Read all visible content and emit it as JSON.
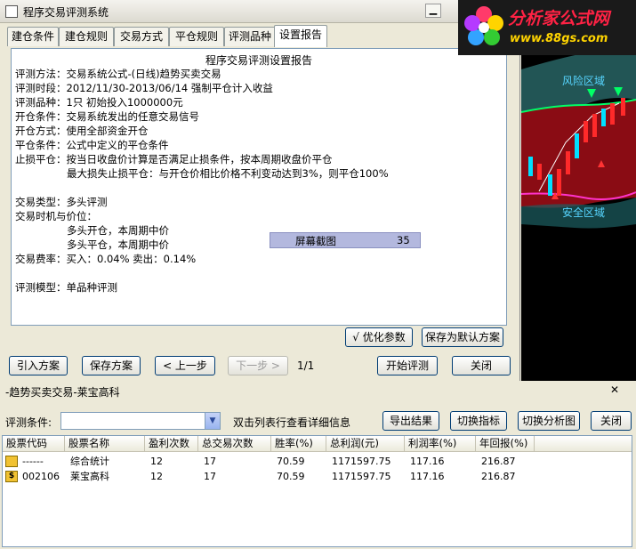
{
  "window": {
    "title": "程序交易评测系统",
    "minimize_glyph": "▁"
  },
  "tabs": [
    {
      "label": "建仓条件"
    },
    {
      "label": "建仓规则"
    },
    {
      "label": "交易方式"
    },
    {
      "label": "平仓规则"
    },
    {
      "label": "评测品种"
    },
    {
      "label": "设置报告"
    }
  ],
  "report": {
    "title": "程序交易评测设置报告",
    "lines": [
      "评测方法：交易系统公式-(日线)趋势买卖交易",
      "评测时段：2012/11/30-2013/06/14 强制平仓计入收益",
      "评测品种：1只 初始投入1000000元",
      "开仓条件：交易系统发出的任意交易信号",
      "开仓方式：使用全部资金开仓",
      "平仓条件：公式中定义的平仓条件",
      "止损平仓：按当日收盘价计算是否满足止损条件，按本周期收盘价平仓",
      "最大损失止损平仓：与开仓价相比价格不利变动达到3%，则平仓100%",
      "交易类型：多头评测",
      "交易时机与价位：",
      "多头开仓，本周期中价",
      "多头平仓，本周期中价",
      "交易费率：买入：0.04%    卖出：0.14%",
      "评测模型：单品种评测"
    ]
  },
  "badge": {
    "label": "屏幕截图",
    "number": "35"
  },
  "buttons": {
    "optimize": "√ 优化参数",
    "save_default": "保存为默认方案",
    "import": "引入方案",
    "save": "保存方案",
    "prev": "< 上一步",
    "next": "下一步 >",
    "page": "1/1",
    "start": "开始评测",
    "close": "关闭"
  },
  "chart": {
    "risk_label": "风险区域",
    "safe_label": "安全区域"
  },
  "logo": {
    "name": "分析家公式网",
    "url": "www.88gs.com"
  },
  "bottom": {
    "title": "-趋势买卖交易-莱宝高科",
    "close_glyph": "✕",
    "condition_label": "评测条件:",
    "condition_value": "",
    "hint": "双击列表行查看详细信息",
    "buttons": {
      "export": "导出结果",
      "switch_indicator": "切换指标",
      "switch_chart": "切换分析图",
      "close": "关闭"
    },
    "table": {
      "headers": [
        "股票代码",
        "股票名称",
        "盈利次数",
        "总交易次数",
        "胜率(%)",
        "总利润(元)",
        "利润率(%)",
        "年回报(%)"
      ],
      "rows": [
        [
          "------",
          "综合统计",
          "12",
          "17",
          "70.59",
          "1171597.75",
          "117.16",
          "216.87"
        ],
        [
          "002106",
          "莱宝高科",
          "12",
          "17",
          "70.59",
          "1171597.75",
          "117.16",
          "216.87"
        ]
      ]
    }
  },
  "colors": {
    "accent_blue": "#003c74",
    "badge_bg": "#b3b8de",
    "candle_up": "#ff2a2a",
    "candle_down": "#00e0ff",
    "band_top": "#00ff66",
    "band_bottom": "#ff33cc"
  }
}
